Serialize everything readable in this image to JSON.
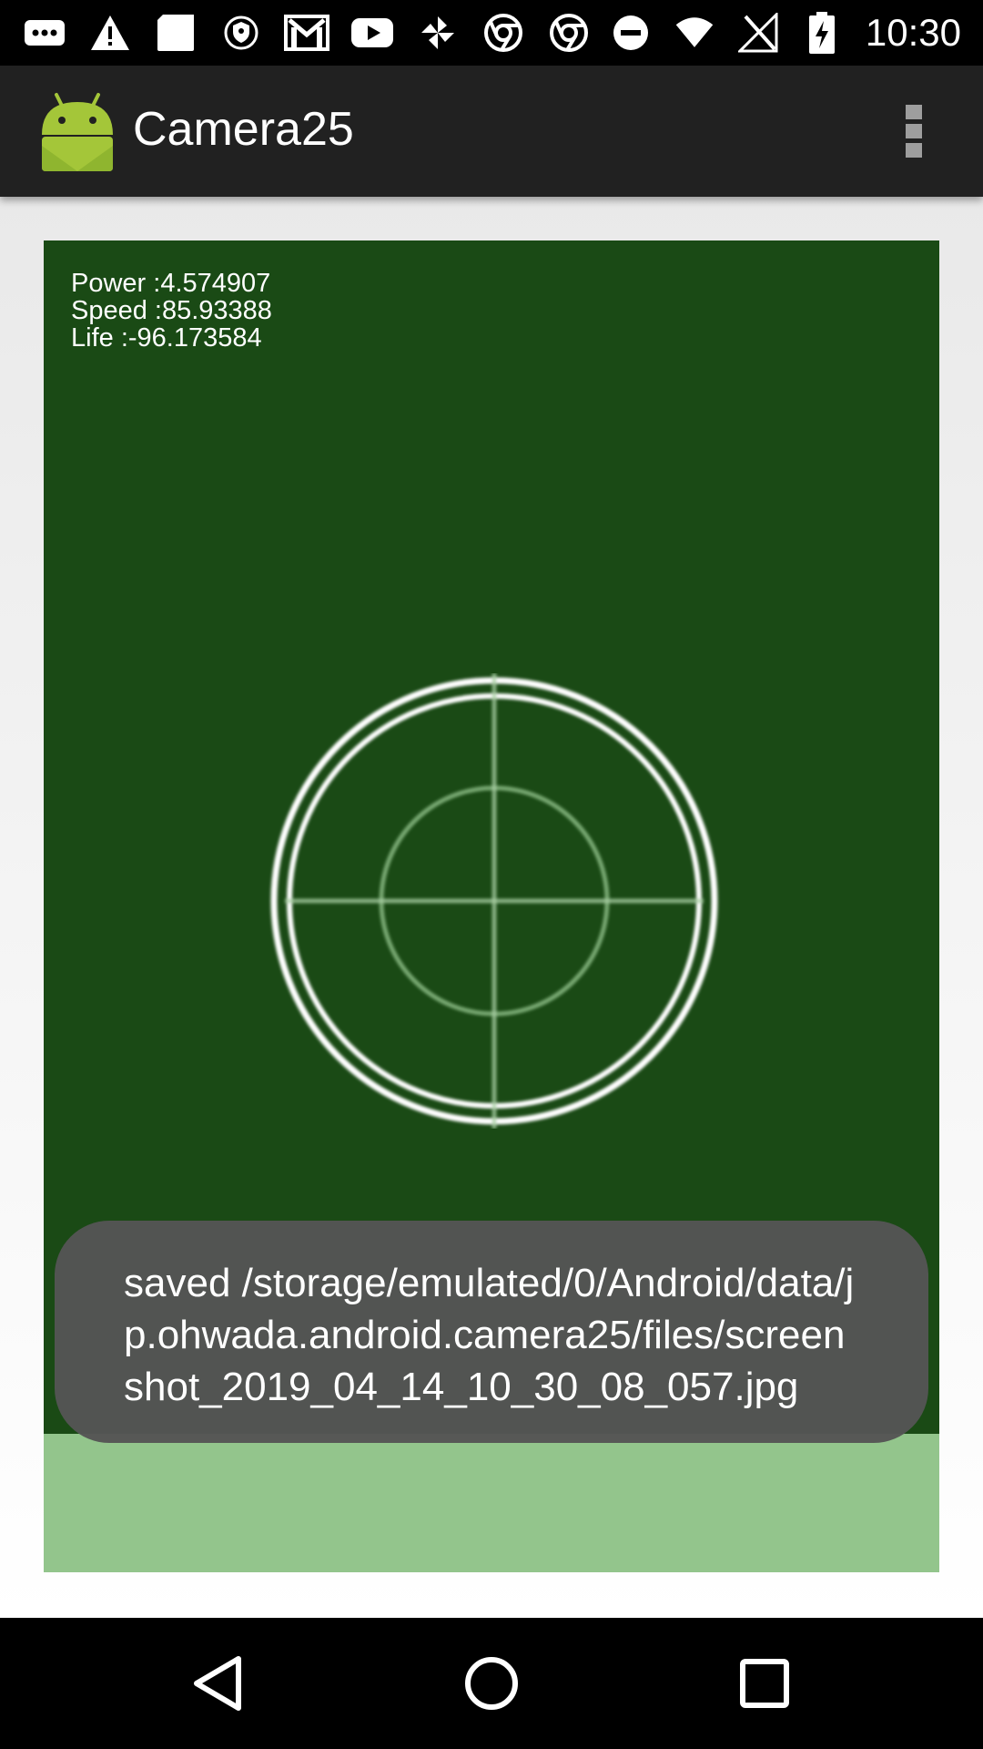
{
  "status_bar": {
    "time": "10:30",
    "left_icons": [
      "more-notifications-icon",
      "warning-icon",
      "sd-card-icon",
      "vpn-key-icon",
      "gmail-icon",
      "youtube-icon",
      "pinwheel-icon",
      "chrome-icon",
      "chrome-icon"
    ],
    "right_icons": [
      "do-not-disturb-icon",
      "wifi-icon",
      "no-signal-icon",
      "battery-charging-icon"
    ]
  },
  "app_bar": {
    "title": "Camera25",
    "menu_icon": "overflow-menu-icon"
  },
  "camera": {
    "hud": {
      "power": "Power :4.574907",
      "speed": "Speed :85.93388",
      "life": "Life :-96.173584"
    },
    "reticle_icon": "crosshair-reticle",
    "colors": {
      "view": "#1a4a15",
      "bottom": "#93c58c"
    }
  },
  "toast": {
    "message": "saved /storage/emulated/0/Android/data/jp.ohwada.android.camera25/files/screenshot_2019_04_14_10_30_08_057.jpg"
  },
  "nav_bar": {
    "back_icon": "back-icon",
    "home_icon": "home-icon",
    "recents_icon": "recents-icon"
  }
}
